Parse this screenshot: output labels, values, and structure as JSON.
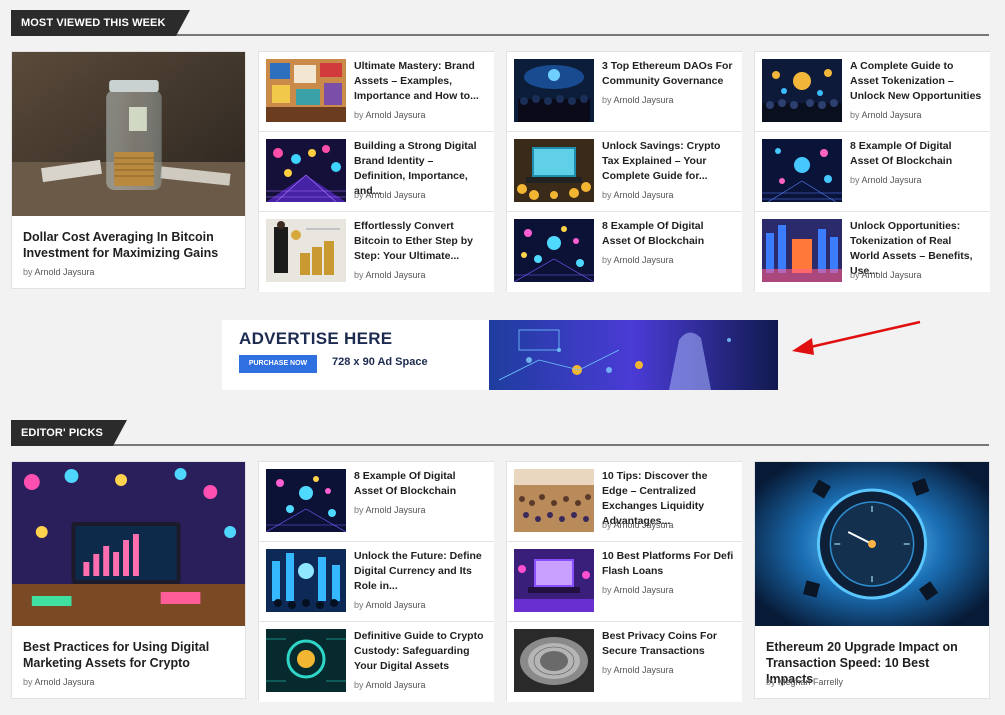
{
  "most_viewed": {
    "heading": "MOST VIEWED THIS WEEK",
    "featured": {
      "title": "Dollar Cost Averaging In Bitcoin Investment for Maximizing Gains",
      "by": "by",
      "author": "Arnold Jaysura"
    },
    "columns": [
      [
        {
          "title": "Ultimate Mastery: Brand Assets – Examples, Importance and How to...",
          "author": "Arnold Jaysura"
        },
        {
          "title": "Building a Strong Digital Brand Identity – Definition, Importance, and...",
          "author": "Arnold Jaysura"
        },
        {
          "title": "Effortlessly Convert Bitcoin to Ether Step by Step: Your Ultimate...",
          "author": "Arnold Jaysura"
        }
      ],
      [
        {
          "title": "3 Top Ethereum DAOs For Community Governance",
          "author": "Arnold Jaysura"
        },
        {
          "title": "Unlock Savings: Crypto Tax Explained – Your Complete Guide for...",
          "author": "Arnold Jaysura"
        },
        {
          "title": "8 Example Of Digital Asset Of Blockchain",
          "author": "Arnold Jaysura"
        }
      ],
      [
        {
          "title": "A Complete Guide to Asset Tokenization – Unlock New Opportunities",
          "author": "Arnold Jaysura"
        },
        {
          "title": "8 Example Of Digital Asset Of Blockchain",
          "author": "Arnold Jaysura"
        },
        {
          "title": "Unlock Opportunities: Tokenization of Real World Assets – Benefits, Use...",
          "author": "Arnold Jaysura"
        }
      ]
    ]
  },
  "ad": {
    "title": "ADVERTISE HERE",
    "button": "PURCHASE NOW",
    "size": "728 x 90 Ad Space"
  },
  "editors_picks": {
    "heading": "EDITOR' PICKS",
    "featured_left": {
      "title": "Best Practices for Using Digital Marketing Assets for Crypto",
      "by": "by",
      "author": "Arnold Jaysura"
    },
    "columns": [
      [
        {
          "title": "8 Example Of Digital Asset Of Blockchain",
          "author": "Arnold Jaysura"
        },
        {
          "title": "Unlock the Future: Define Digital Currency and Its Role in...",
          "author": "Arnold Jaysura"
        },
        {
          "title": "Definitive Guide to Crypto Custody: Safeguarding Your Digital Assets",
          "author": "Arnold Jaysura"
        }
      ],
      [
        {
          "title": "10 Tips: Discover the Edge – Centralized Exchanges Liquidity Advantages...",
          "author": "Arnold Jaysura"
        },
        {
          "title": "10 Best Platforms For Defi Flash Loans",
          "author": "Arnold Jaysura"
        },
        {
          "title": "Best Privacy Coins For Secure Transactions",
          "author": "Arnold Jaysura"
        }
      ]
    ],
    "featured_right": {
      "title": "Ethereum 20 Upgrade Impact on Transaction Speed: 10 Best Impacts",
      "by": "by",
      "author": "Meghan Farrelly"
    }
  },
  "by_label": "by",
  "colors": {
    "tab_bg": "#2b2b2b",
    "arrow": "#e01010",
    "ad_button": "#2f6fe0"
  }
}
